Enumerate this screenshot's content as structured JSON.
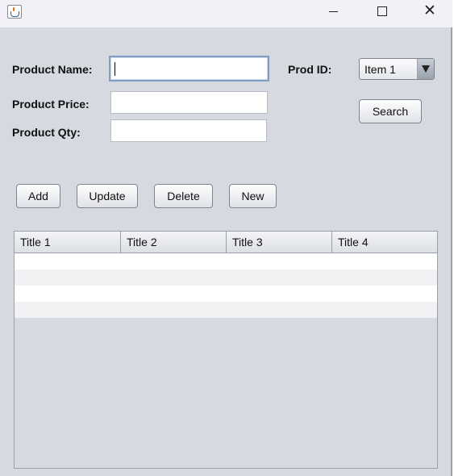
{
  "window": {
    "title": ""
  },
  "form": {
    "product_name_label": "Product Name:",
    "product_price_label": "Product Price:",
    "product_qty_label": "Product Qty:",
    "product_name_value": "",
    "product_price_value": "",
    "product_qty_value": "",
    "prod_id_label": "Prod ID:",
    "prod_id_selected": "Item 1",
    "search_label": "Search"
  },
  "actions": {
    "add_label": "Add",
    "update_label": "Update",
    "delete_label": "Delete",
    "new_label": "New"
  },
  "table": {
    "columns": [
      "Title 1",
      "Title 2",
      "Title 3",
      "Title 4"
    ],
    "rows": [
      [
        "",
        "",
        "",
        ""
      ],
      [
        "",
        "",
        "",
        ""
      ],
      [
        "",
        "",
        "",
        ""
      ],
      [
        "",
        "",
        "",
        ""
      ]
    ]
  },
  "colors": {
    "window_bg": "#d6d9e0",
    "titlebar_bg": "#f4f0f8",
    "row_even": "#ffffff",
    "row_odd": "#f1f1f3",
    "focus_border": "#7e9fc3"
  }
}
